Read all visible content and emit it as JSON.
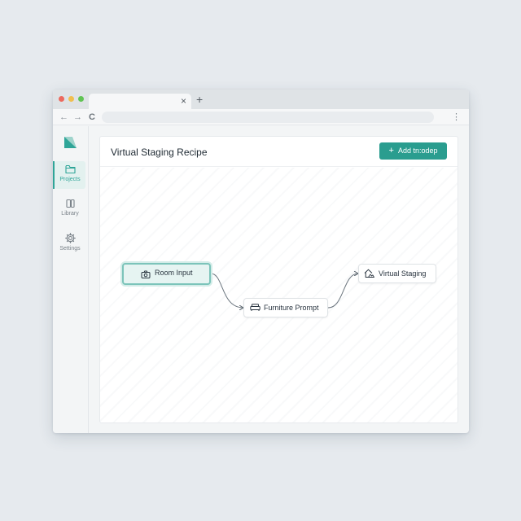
{
  "browser": {
    "tab_close": "×",
    "new_tab": "+",
    "back": "←",
    "forward": "→",
    "reload": "C",
    "menu": "⋮"
  },
  "sidebar": {
    "items": [
      {
        "label": "Projects",
        "icon": "folder-icon",
        "active": true
      },
      {
        "label": "Library",
        "icon": "library-icon",
        "active": false
      },
      {
        "label": "Settings",
        "icon": "gear-icon",
        "active": false
      }
    ]
  },
  "header": {
    "title": "Virtual Staging Recipe",
    "add_button_icon": "+",
    "add_button_label": "Add tn:odep"
  },
  "canvas": {
    "nodes": [
      {
        "label": "Room Input",
        "icon": "camera-icon",
        "selected": true
      },
      {
        "label": "Furniture Prompt",
        "icon": "sofa-icon",
        "selected": false
      },
      {
        "label": "Virtual Staging",
        "icon": "home-icon",
        "selected": false
      }
    ]
  },
  "colors": {
    "accent": "#2a9d8f",
    "selected_node_bg": "#e6f4f2",
    "page_bg": "#e6eaee"
  }
}
